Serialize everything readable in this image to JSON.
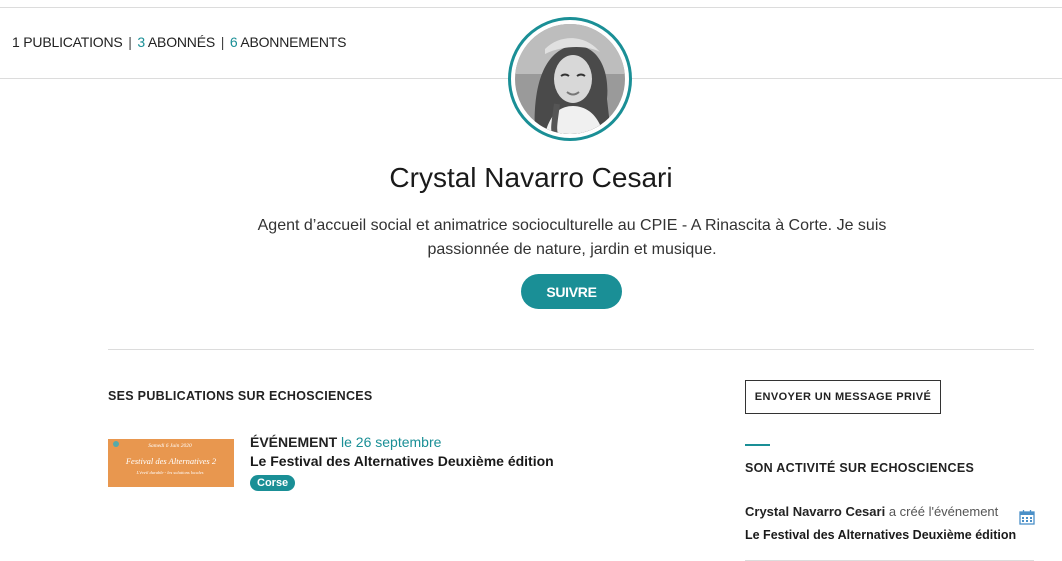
{
  "stats": {
    "publications_count": "1",
    "publications_label": "PUBLICATIONS",
    "subscribers_count": "3",
    "subscribers_label": "ABONNÉS",
    "subscriptions_count": "6",
    "subscriptions_label": "ABONNEMENTS",
    "separator": "|"
  },
  "profile": {
    "name": "Crystal Navarro Cesari",
    "bio": "Agent d’accueil social et animatrice socioculturelle au CPIE - A Rinascita à Corte. Je suis passionnée de nature, jardin et musique.",
    "follow_label": "SUIVRE"
  },
  "publications": {
    "title": "SES PUBLICATIONS SUR ECHOSCIENCES",
    "items": [
      {
        "type": "ÉVÉNEMENT",
        "date": "le 26 septembre",
        "title": "Le Festival des Alternatives Deuxième édition",
        "tag": "Corse",
        "thumb_heading": "Samedi 6 Juin 2020",
        "thumb_title": "Festival des Alternatives 2",
        "thumb_subtitle": "L'éveil durable - les solutions locales"
      }
    ]
  },
  "sidebar": {
    "message_button": "ENVOYER UN MESSAGE PRIVÉ",
    "activity_title": "SON ACTIVITÉ SUR ECHOSCIENCES",
    "activity": [
      {
        "user": "Crystal Navarro Cesari",
        "verb": "a créé l'événement",
        "object": "Le Festival des Alternatives Deuxième édition",
        "icon": "calendar-icon"
      }
    ]
  },
  "colors": {
    "accent": "#1a8f96",
    "thumb_bg": "#e8974f"
  }
}
